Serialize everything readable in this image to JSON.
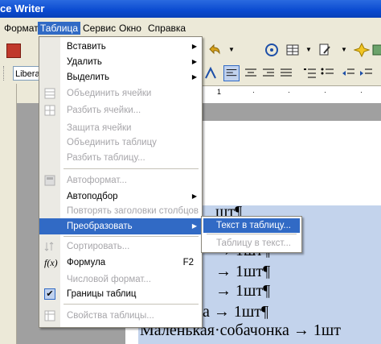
{
  "window": {
    "title": "ce Writer"
  },
  "menubar": {
    "items": [
      {
        "label": "Формат"
      },
      {
        "label": "Таблица"
      },
      {
        "label": "Сервис"
      },
      {
        "label": "Окно"
      },
      {
        "label": "Справка"
      }
    ]
  },
  "style_box": {
    "value": "Liberat"
  },
  "table_menu": {
    "items": [
      {
        "label": "Вставить",
        "submenu": true
      },
      {
        "label": "Удалить",
        "submenu": true
      },
      {
        "label": "Выделить",
        "submenu": true
      },
      {
        "label": "Объединить ячейки",
        "disabled": true
      },
      {
        "label": "Разбить ячейки...",
        "disabled": true
      },
      {
        "label": "Защита ячейки",
        "disabled": true
      },
      {
        "label": "Объединить таблицу",
        "disabled": true
      },
      {
        "label": "Разбить таблицу...",
        "disabled": true
      },
      {
        "label": "Автоформат...",
        "disabled": true
      },
      {
        "label": "Автоподбор",
        "submenu": true
      },
      {
        "label": "Повторять заголовки столбцов",
        "disabled": true
      },
      {
        "label": "Преобразовать",
        "submenu": true,
        "highlighted": true
      },
      {
        "label": "Сортировать...",
        "disabled": true
      },
      {
        "label": "Формула",
        "shortcut": "F2"
      },
      {
        "label": "Числовой формат...",
        "disabled": true
      },
      {
        "label": "Границы таблиц"
      },
      {
        "label": "Свойства таблицы...",
        "disabled": true
      }
    ]
  },
  "convert_submenu": {
    "items": [
      {
        "label": "Текст в таблицу...",
        "highlighted": true
      },
      {
        "label": "Таблицу в текст...",
        "disabled": true
      }
    ]
  },
  "document": {
    "lines": [
      "шт¶",
      "→     1шт¶",
      "→     1шт¶",
      "→     1шт¶",
      "а     →     1шт¶",
      "Маленькая·собачонка     →     1шт"
    ]
  },
  "colors": {
    "highlight": "#316ac5",
    "selection": "#c3d3ec",
    "title_bar": "#0a4ad0"
  }
}
